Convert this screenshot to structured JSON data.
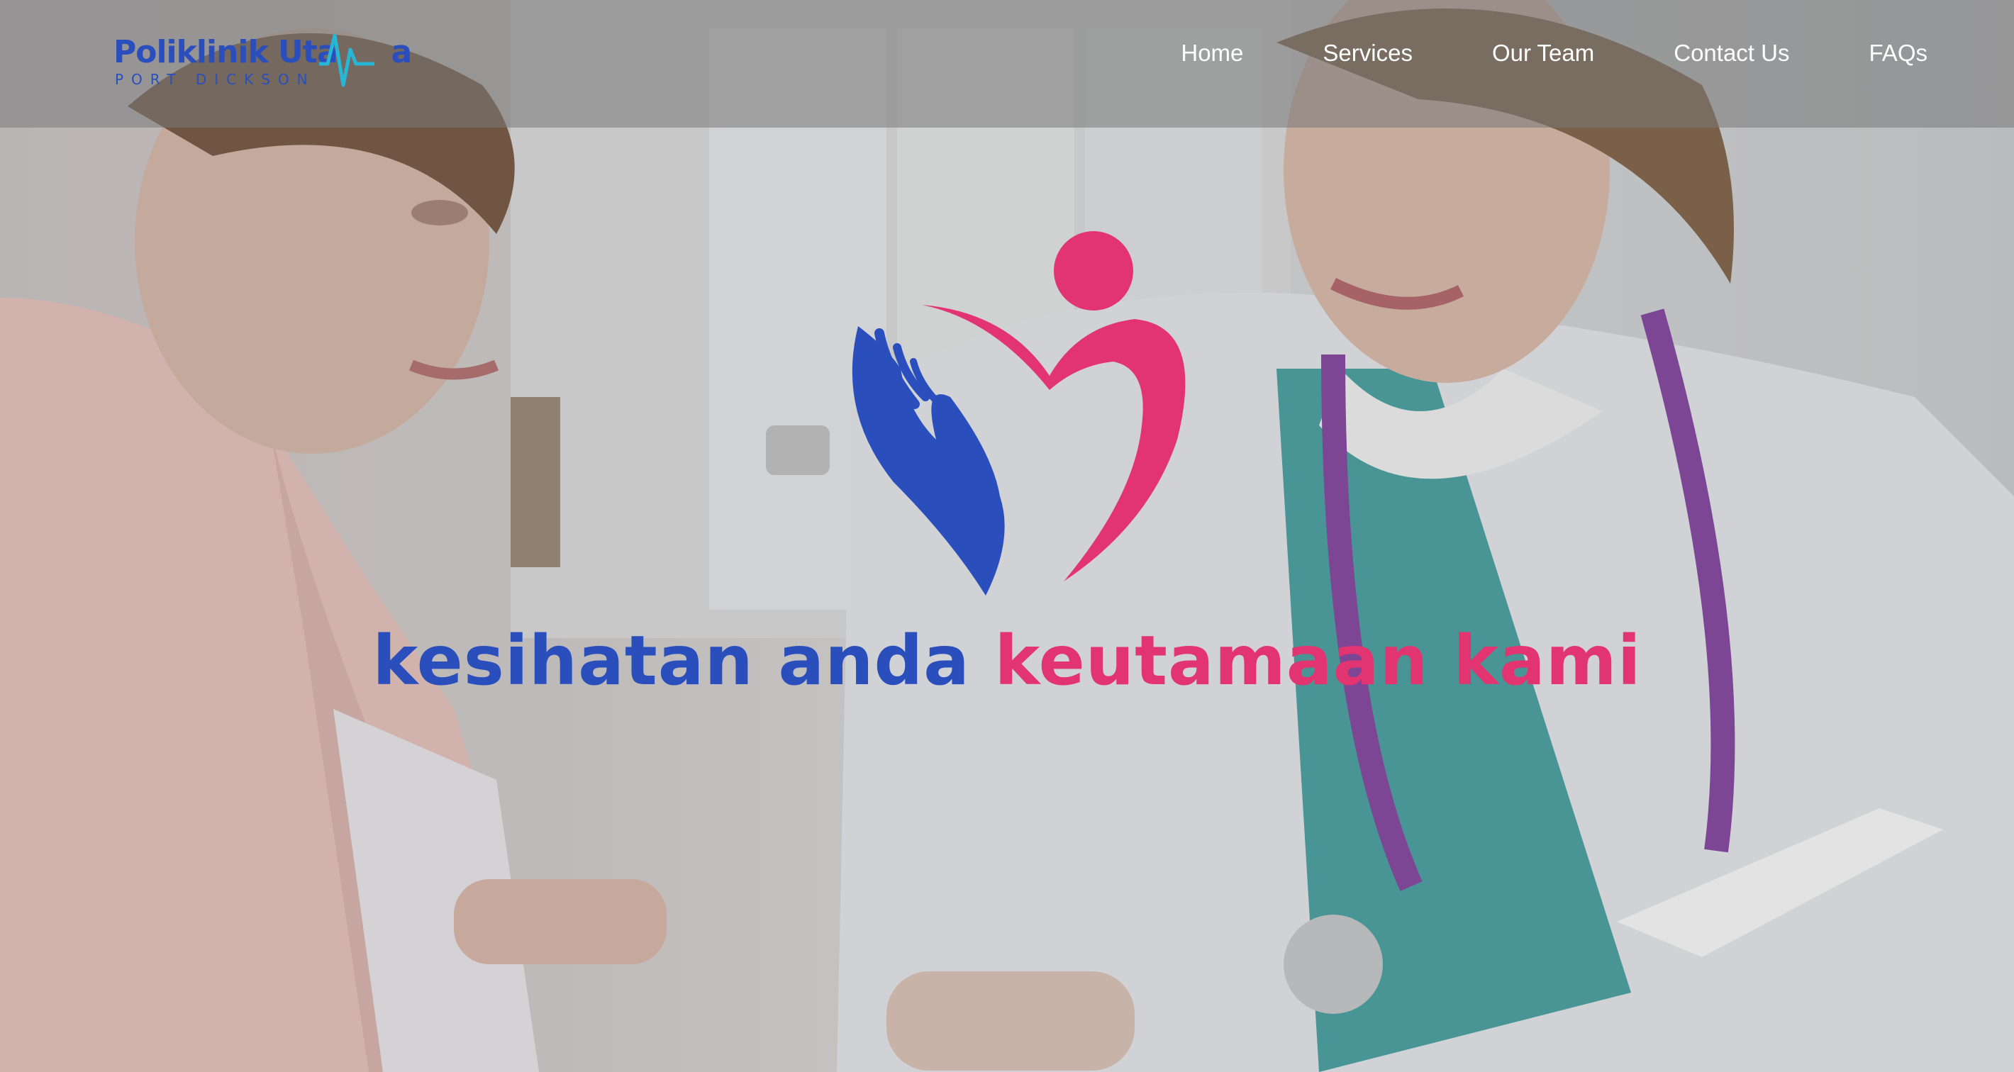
{
  "brand": {
    "name": "Poliklinik Uta",
    "name_end": "a",
    "subtitle": "PORT DICKSON"
  },
  "nav": {
    "items": [
      {
        "label": "Home"
      },
      {
        "label": "Services"
      },
      {
        "label": "Our Team"
      },
      {
        "label": "Contact Us"
      },
      {
        "label": "FAQs"
      }
    ]
  },
  "hero": {
    "slogan_part1": "kesihatan anda",
    "slogan_part2": "keutamaan kami"
  },
  "colors": {
    "brand_blue": "#2a4fbd",
    "brand_pink": "#e23470",
    "pulse_cyan": "#27b6d6",
    "nav_text": "#ffffff"
  }
}
